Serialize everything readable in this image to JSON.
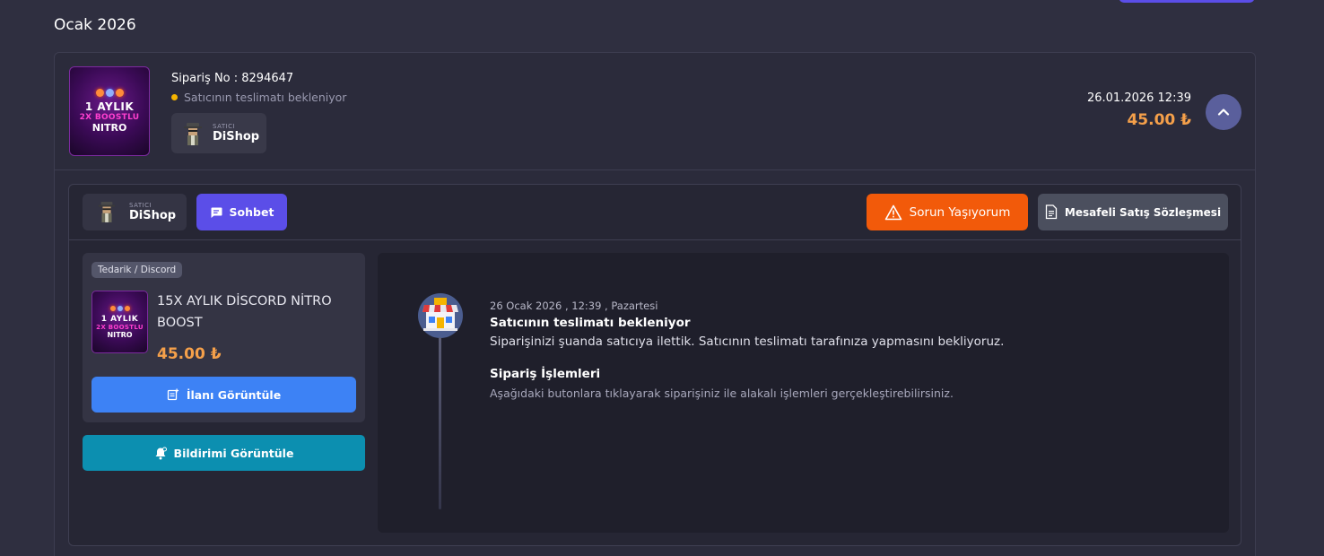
{
  "month": "Ocak 2026",
  "order": {
    "number_label": "Sipariş No : 8294647",
    "status": "Satıcının teslimatı bekleniyor",
    "seller_sub": "SATICI",
    "seller_name": "DiShop",
    "date": "26.01.2026 12:39",
    "price": "45.00 ₺",
    "thumb": {
      "line1": "1 AYLIK",
      "line2": "2X BOOSTLU",
      "line3": "NITRO"
    }
  },
  "toolbar": {
    "seller_sub": "SATICI",
    "seller_name": "DiShop",
    "chat_label": "Sohbet",
    "problem_label": "Sorun Yaşıyorum",
    "contract_label": "Mesafeli Satış Sözleşmesi"
  },
  "product": {
    "category": "Tedarik / Discord",
    "title": "15X AYLIK DİSCORD NİTRO BOOST",
    "price": "45.00 ₺",
    "view_listing_label": "İlanı Görüntüle",
    "view_notice_label": "Bildirimi Görüntüle"
  },
  "timeline": {
    "date": "26 Ocak 2026 , 12:39 , Pazartesi",
    "title": "Satıcının teslimatı bekleniyor",
    "text": "Siparişinizi şuanda satıcıya ilettik. Satıcının teslimatı tarafınıza yapmasını bekliyoruz.",
    "actions_title": "Sipariş İşlemleri",
    "actions_text": "Aşağıdaki butonlara tıklayarak siparişiniz ile alakalı işlemleri gerçekleştirebilirsiniz."
  },
  "colors": {
    "accent": "#5b4ee8",
    "price": "#f5a04a",
    "status_dot": "#f5b400",
    "problem": "#f25a0a",
    "listing": "#3d82f5",
    "notice": "#0c8fb0"
  }
}
